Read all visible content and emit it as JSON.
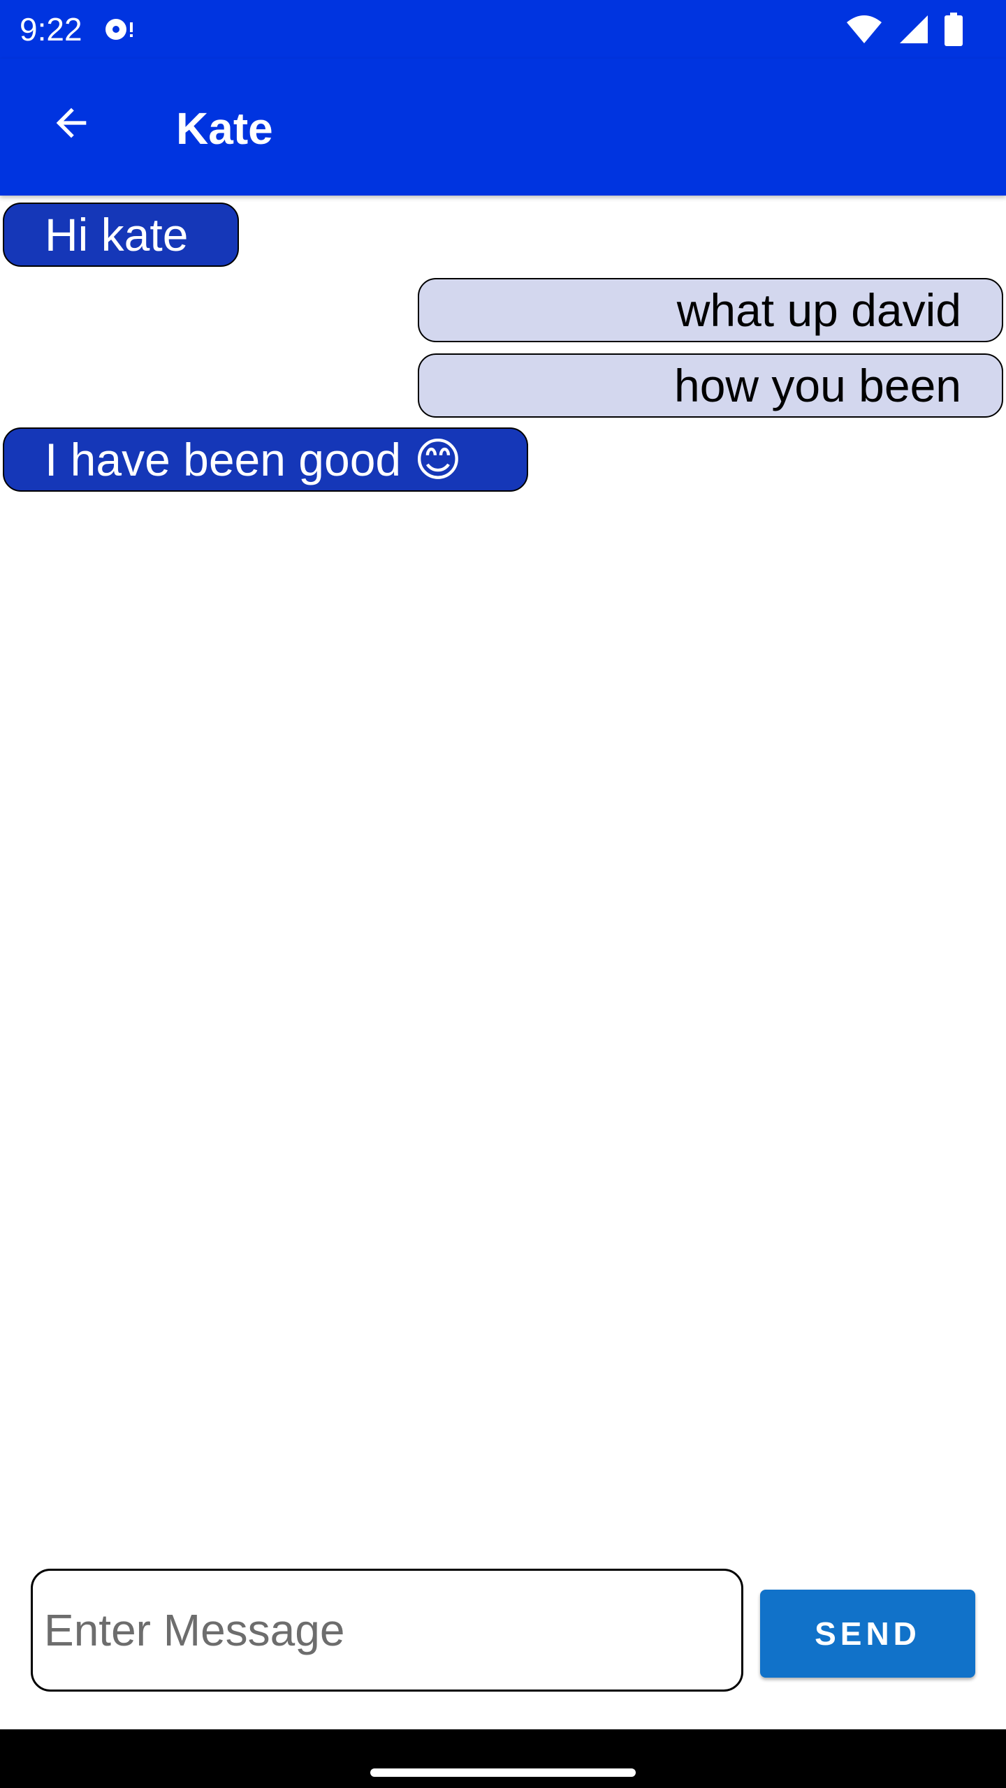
{
  "status_bar": {
    "time": "9:22",
    "icons": [
      "media-icon",
      "wifi-icon",
      "signal-icon",
      "battery-icon"
    ]
  },
  "app_bar": {
    "title": "Kate",
    "back_icon": "arrow-left-icon",
    "background_color": "#0034e0"
  },
  "messages": [
    {
      "text": "Hi kate",
      "direction": "received"
    },
    {
      "text": "what up david",
      "direction": "sent"
    },
    {
      "text": "how you been",
      "direction": "sent"
    },
    {
      "text": "I have been good 😊",
      "direction": "received"
    }
  ],
  "colors": {
    "received_bubble": "#1537b8",
    "sent_bubble": "#d3d7ee",
    "send_button": "#1172c9"
  },
  "composer": {
    "placeholder": "Enter Message",
    "value": "",
    "send_label": "SEND"
  }
}
